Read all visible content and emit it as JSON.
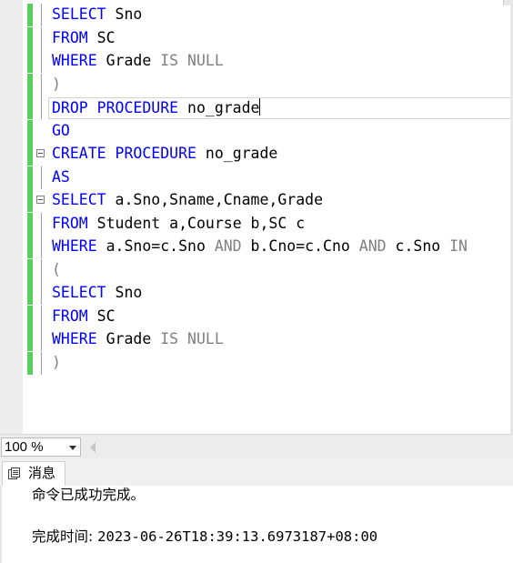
{
  "editor": {
    "lines": [
      {
        "parts": [
          {
            "t": "SELECT",
            "c": "kw"
          },
          {
            "t": " Sno",
            "c": ""
          }
        ],
        "bar": true,
        "fold": "line"
      },
      {
        "parts": [
          {
            "t": "FROM",
            "c": "kw"
          },
          {
            "t": " SC",
            "c": ""
          }
        ],
        "bar": true,
        "fold": "line"
      },
      {
        "parts": [
          {
            "t": "WHERE",
            "c": "kw"
          },
          {
            "t": " Grade ",
            "c": ""
          },
          {
            "t": "IS NULL",
            "c": "gr"
          }
        ],
        "bar": true,
        "fold": "line"
      },
      {
        "parts": [
          {
            "t": ")",
            "c": "gr"
          }
        ],
        "bar": true,
        "fold": "line"
      },
      {
        "parts": [
          {
            "t": "DROP PROCEDURE",
            "c": "kw"
          },
          {
            "t": " no_grade",
            "c": ""
          }
        ],
        "bar": true,
        "fold": "line",
        "current": true
      },
      {
        "parts": [
          {
            "t": "GO",
            "c": "kw"
          }
        ],
        "bar": true,
        "fold": ""
      },
      {
        "parts": [
          {
            "t": "CREATE PROCEDURE",
            "c": "kw"
          },
          {
            "t": " no_grade",
            "c": ""
          }
        ],
        "bar": true,
        "fold": "box"
      },
      {
        "parts": [
          {
            "t": "AS",
            "c": "kw"
          }
        ],
        "bar": true,
        "fold": "line"
      },
      {
        "parts": [
          {
            "t": "SELECT",
            "c": "kw"
          },
          {
            "t": " a.Sno,Sname,Cname,Grade",
            "c": ""
          }
        ],
        "bar": true,
        "fold": "box"
      },
      {
        "parts": [
          {
            "t": "FROM",
            "c": "kw"
          },
          {
            "t": " Student a,Course b,SC c",
            "c": ""
          }
        ],
        "bar": true,
        "fold": "line"
      },
      {
        "parts": [
          {
            "t": "WHERE",
            "c": "kw"
          },
          {
            "t": " a.Sno=c.Sno ",
            "c": ""
          },
          {
            "t": "AND",
            "c": "gr"
          },
          {
            "t": " b.Cno=c.Cno ",
            "c": ""
          },
          {
            "t": "AND",
            "c": "gr"
          },
          {
            "t": " c.Sno ",
            "c": ""
          },
          {
            "t": "IN",
            "c": "gr"
          }
        ],
        "bar": true,
        "fold": "line"
      },
      {
        "parts": [
          {
            "t": "(",
            "c": "gr"
          }
        ],
        "bar": true,
        "fold": "line"
      },
      {
        "parts": [
          {
            "t": "SELECT",
            "c": "kw"
          },
          {
            "t": " Sno",
            "c": ""
          }
        ],
        "bar": true,
        "fold": "line"
      },
      {
        "parts": [
          {
            "t": "FROM",
            "c": "kw"
          },
          {
            "t": " SC",
            "c": ""
          }
        ],
        "bar": true,
        "fold": "line"
      },
      {
        "parts": [
          {
            "t": "WHERE",
            "c": "kw"
          },
          {
            "t": " Grade ",
            "c": ""
          },
          {
            "t": "IS NULL",
            "c": "gr"
          }
        ],
        "bar": true,
        "fold": "line"
      },
      {
        "parts": [
          {
            "t": ")",
            "c": "gr"
          }
        ],
        "bar": true,
        "fold": "line"
      }
    ]
  },
  "statusbar": {
    "zoom": "100 %"
  },
  "results": {
    "tab_label": "消息",
    "message": "命令已成功完成。",
    "completion_label": "完成时间: ",
    "completion_time": "2023-06-26T18:39:13.6973187+08:00"
  },
  "colors": {
    "keyword": "#0000ff",
    "operator": "#808080",
    "change_bar": "#57d05f"
  }
}
